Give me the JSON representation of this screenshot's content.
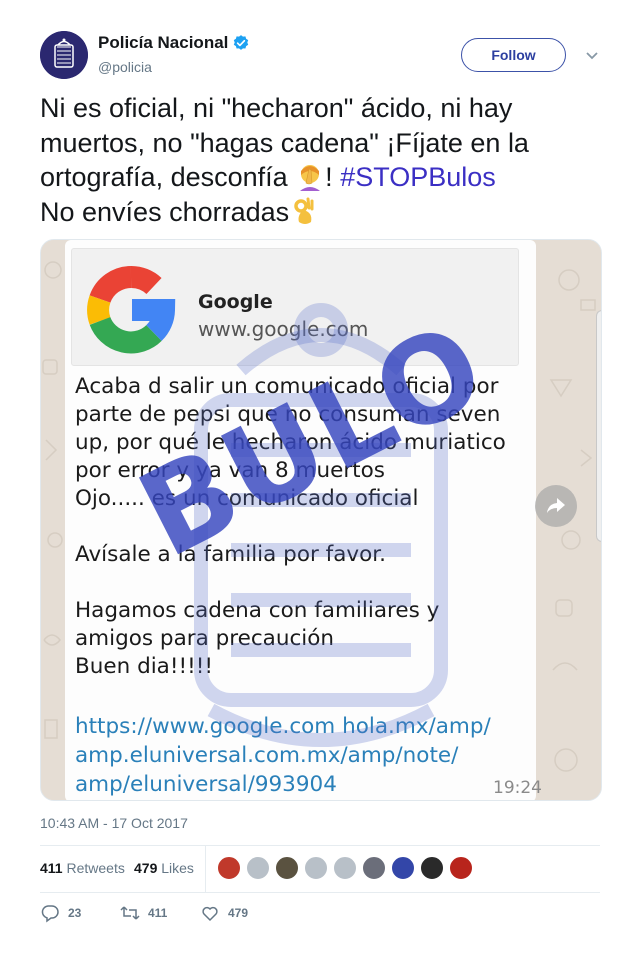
{
  "user": {
    "display_name": "Policía Nacional",
    "handle": "@policia",
    "follow_label": "Follow"
  },
  "tweet": {
    "text_part1": "Ni es oficial, ni \"hecharon\" ácido, ni hay muertos, no \"hagas cadena\" ¡Fíjate en la ortografía, desconfía",
    "text_part2": "!",
    "hashtag": "#STOPBulos",
    "text_part3": "No envíes chorradas",
    "timestamp": "10:43 AM - 17 Oct 2017"
  },
  "media": {
    "preview_title": "Google",
    "preview_url": "www.google.com",
    "message": "Acaba d salir un comunicado oficial por\nparte de pepsi que no consuman seven\nup, por qué le hecharon ácido muriatico\npor error y ya van 8 muertos\nOjo..... es un comunicado oficial\n\nAvísale a la familia por favor.\n\nHagamos cadena con familiares y\namigos para precaución\nBuen dia!!!!!",
    "link": "https://www.google.com hola.mx/amp/\namp.eluniversal.com.mx/amp/note/\namp/eluniversal/993904",
    "time": "19:24",
    "stamp_text": "BULO"
  },
  "stats": {
    "retweets_count": "411",
    "retweets_label": "Retweets",
    "likes_count": "479",
    "likes_label": "Likes"
  },
  "actions": {
    "replies": "23",
    "retweets": "411",
    "likes": "479"
  },
  "colors": {
    "accent": "#3b2fc4",
    "follow_border": "#3c52a8",
    "stamp": "#3646be",
    "link": "#2a80b9"
  }
}
